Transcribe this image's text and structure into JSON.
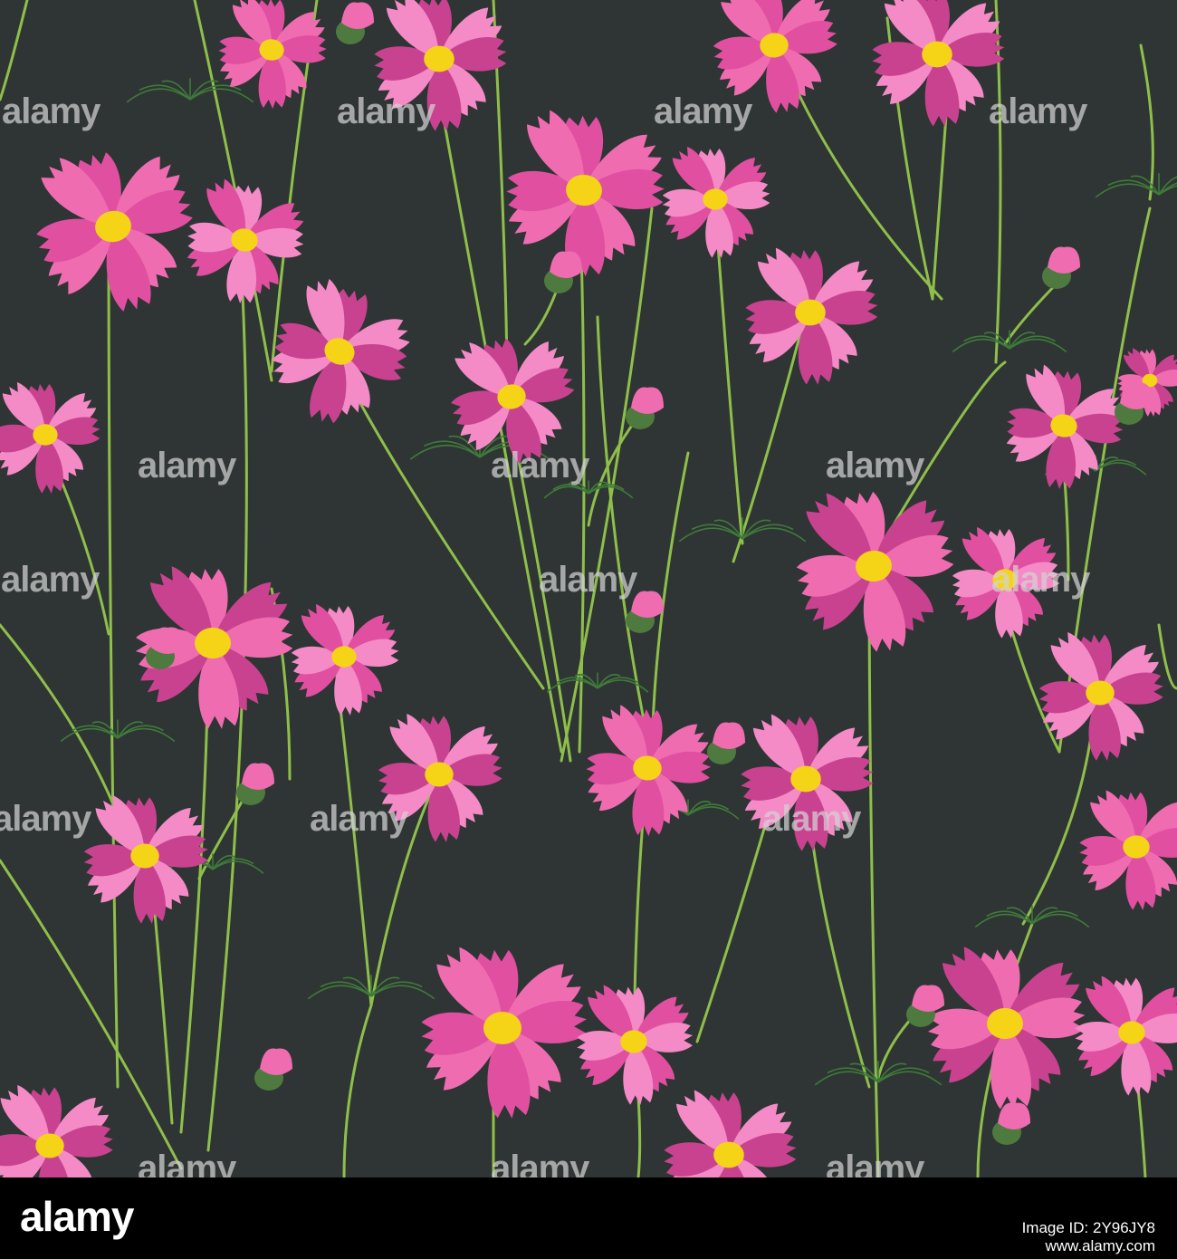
{
  "image": {
    "subject": "seamless pattern of pink cosmos flowers with green stems",
    "background_color": "#2f3534",
    "petal_colors": [
      "#e04fa0",
      "#f06cb0",
      "#c8428f",
      "#f48ac6"
    ],
    "center_color": "#f5d417",
    "stem_color": "#8fbf4a",
    "leaf_color": "#3f7a3a",
    "bud_color": "#4f7a3f"
  },
  "watermark": {
    "text": "alamy"
  },
  "footer": {
    "logo_text": "alamy",
    "image_id_text": "Image ID: 2Y96JY8\nwww.alamy.com",
    "background_color": "#000000"
  }
}
